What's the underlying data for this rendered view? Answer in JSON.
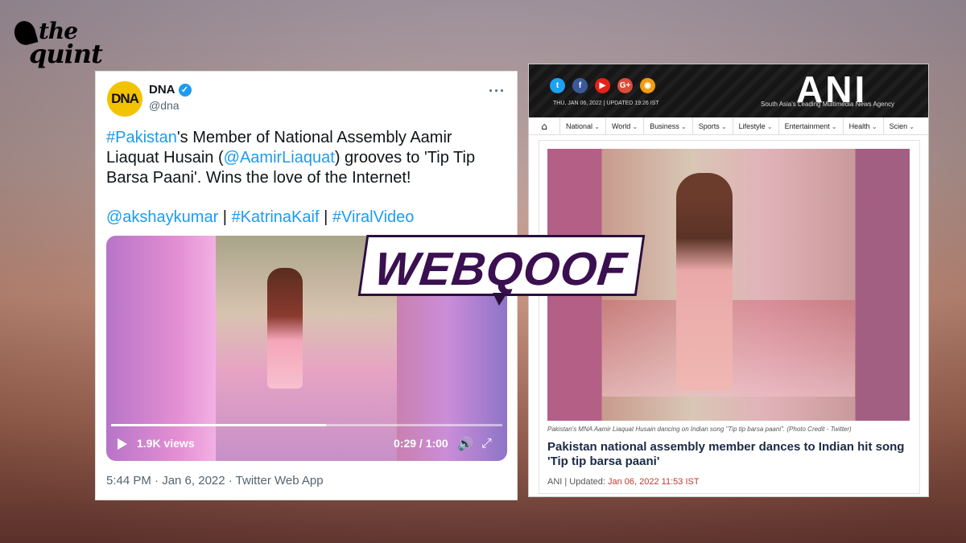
{
  "logo": {
    "line1": "the",
    "line2": "quint"
  },
  "tweet": {
    "avatar_text": "DNA",
    "name": "DNA",
    "handle": "@dna",
    "more": "···",
    "text_parts": [
      {
        "t": "#Pakistan",
        "link": true
      },
      {
        "t": "'s Member of National Assembly Aamir Liaquat Husain (",
        "link": false
      },
      {
        "t": "@AamirLiaquat",
        "link": true
      },
      {
        "t": ") grooves to 'Tip Tip Barsa Paani'. Wins the love of the Internet!",
        "link": false
      }
    ],
    "tags": [
      "@akshaykumar",
      "#KatrinaKaif",
      "#ViralVideo"
    ],
    "tag_sep": " | ",
    "video": {
      "views": "1.9K views",
      "time": "0:29 / 1:00",
      "progress": 0.55
    },
    "meta": "5:44 PM · Jan 6, 2022 · Twitter Web App"
  },
  "ani": {
    "social": [
      {
        "icon": "twitter-icon",
        "glyph": "t",
        "color": "#1da1f2"
      },
      {
        "icon": "facebook-icon",
        "glyph": "f",
        "color": "#3b5998"
      },
      {
        "icon": "youtube-icon",
        "glyph": "▶",
        "color": "#e62117"
      },
      {
        "icon": "google-plus-icon",
        "glyph": "G+",
        "color": "#dd4b39"
      },
      {
        "icon": "rss-icon",
        "glyph": "◉",
        "color": "#f39c12"
      }
    ],
    "date": "THU, JAN 06, 2022 | UPDATED 19:26 IST",
    "logo": "ANI",
    "tagline": "South Asia's Leading Multimedia News Agency",
    "nav": [
      "National",
      "World",
      "Business",
      "Sports",
      "Lifestyle",
      "Entertainment",
      "Health",
      "Scien"
    ],
    "caption": "Pakistan's MNA Aamir Liaquat Husain dancing on Indian song \"Tip tip barsa paani\". (Photo Credit - Twitter)",
    "title": "Pakistan national assembly member dances to Indian hit song 'Tip tip barsa paani'",
    "meta_source": "ANI | Updated: ",
    "meta_date": "Jan 06, 2022 11:53 IST"
  },
  "badge": "WEBQOOF"
}
